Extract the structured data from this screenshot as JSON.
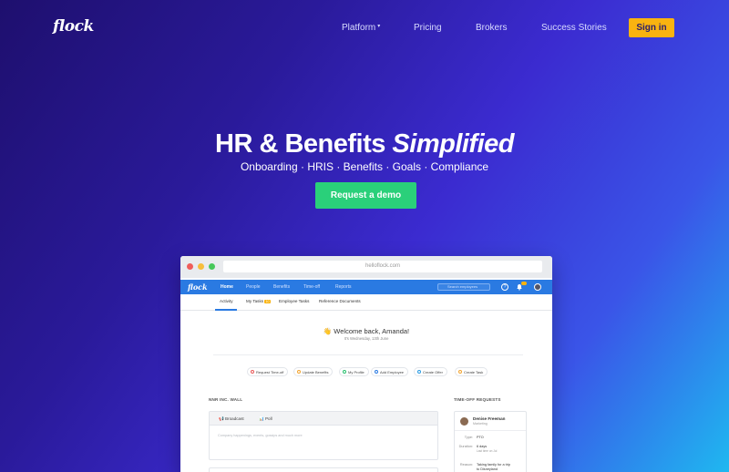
{
  "nav": {
    "logo": "flock",
    "platform": "Platform",
    "platform_caret": "▾",
    "pricing": "Pricing",
    "brokers": "Brokers",
    "success_stories": "Success Stories",
    "sign_in": "Sign in"
  },
  "hero": {
    "title_main": "HR & Benefits",
    "title_em": "Simplified",
    "subtitle": "Onboarding · HRIS · Benefits · Goals · Compliance",
    "cta": "Request a demo"
  },
  "browser": {
    "url": "helloflock.com",
    "app": {
      "logo": "flock",
      "nav": [
        "Home",
        "People",
        "Benefits",
        "Time-off",
        "Reports"
      ],
      "search_placeholder": "Search employees",
      "help_icon": "?",
      "bell_icon": "🔔"
    },
    "subnav": {
      "activity": "Activity",
      "my_tasks": "My Tasks",
      "my_tasks_count": "10",
      "employee_tasks": "Employee Tasks",
      "reference_documents": "Reference Documents"
    },
    "welcome": "👋 Welcome back, Amanda!",
    "date": "It's Wednesday, 13th June",
    "quick_actions": [
      {
        "label": "Request Time-off",
        "color": "#e85a5a"
      },
      {
        "label": "Update Benefits",
        "color": "#f2a531"
      },
      {
        "label": "My Profile",
        "color": "#2ac06f"
      },
      {
        "label": "Add Employee",
        "color": "#2a7ae2"
      },
      {
        "label": "Create Offer",
        "color": "#2a9be2"
      },
      {
        "label": "Create Task",
        "color": "#f2a531"
      }
    ],
    "wall": {
      "heading": "NNR INC. WALL",
      "broadcast": "📢 Broadcast",
      "poll": "📊 Poll",
      "placeholder": "Company happenings, events, gossips and much more"
    },
    "time_off": {
      "heading": "TIME-OFF REQUESTS",
      "name": "Denise Freeman",
      "role": "Marketing",
      "type_label": "Type:",
      "type_value": "PTO",
      "duration_label": "Duration:",
      "duration_value": "6 days",
      "duration_note": "Last time on Jul",
      "reason_label": "Reason:",
      "reason_line1": "Taking family for a trip",
      "reason_line2": "to Disneyland"
    }
  }
}
